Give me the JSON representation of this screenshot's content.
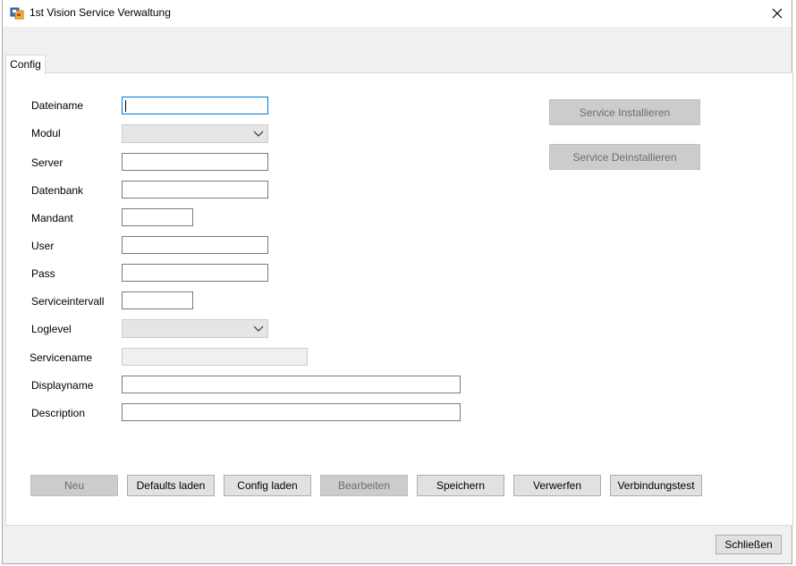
{
  "window": {
    "title": "1st Vision Service Verwaltung"
  },
  "tabs": [
    {
      "label": "Config",
      "selected": true
    }
  ],
  "form": {
    "fields": [
      {
        "label": "Dateiname",
        "type": "text",
        "value": "",
        "focused": true
      },
      {
        "label": "Modul",
        "type": "combo",
        "value": "",
        "enabled": false
      },
      {
        "label": "Server",
        "type": "text",
        "value": ""
      },
      {
        "label": "Datenbank",
        "type": "text",
        "value": ""
      },
      {
        "label": "Mandant",
        "type": "text",
        "value": ""
      },
      {
        "label": "User",
        "type": "text",
        "value": ""
      },
      {
        "label": "Pass",
        "type": "text",
        "value": ""
      },
      {
        "label": "Serviceintervall",
        "type": "text",
        "value": ""
      },
      {
        "label": "Loglevel",
        "type": "combo",
        "value": "",
        "enabled": false
      },
      {
        "label": "Servicename",
        "type": "text",
        "value": "",
        "enabled": false
      },
      {
        "label": "Displayname",
        "type": "text",
        "value": ""
      },
      {
        "label": "Description",
        "type": "text",
        "value": ""
      }
    ]
  },
  "service_buttons": {
    "install_label": "Service Installieren",
    "uninstall_label": "Service Deinstallieren",
    "enabled": false
  },
  "action_buttons": [
    {
      "label": "Neu",
      "enabled": false
    },
    {
      "label": "Defaults laden",
      "enabled": true
    },
    {
      "label": "Config laden",
      "enabled": true
    },
    {
      "label": "Bearbeiten",
      "enabled": false
    },
    {
      "label": "Speichern",
      "enabled": true
    },
    {
      "label": "Verwerfen",
      "enabled": true
    },
    {
      "label": "Verbindungstest",
      "enabled": true
    }
  ],
  "footer": {
    "close_label": "Schließen"
  },
  "colors": {
    "window_bg": "#f0f0f0",
    "focus_border": "#0078d7",
    "disabled_button_bg": "#cccccc"
  }
}
